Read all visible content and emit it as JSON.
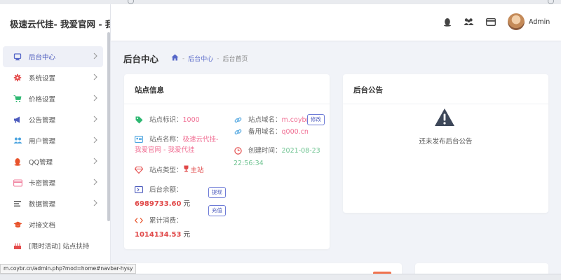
{
  "brand": {
    "title": "极速云代挂- 我爱官网 - 我"
  },
  "sidebar": {
    "items": [
      {
        "label": "后台中心",
        "icon": "monitor-icon",
        "color": "#5667c8",
        "active": true
      },
      {
        "label": "系统设置",
        "icon": "gear-icon",
        "color": "#e44d4d"
      },
      {
        "label": "价格设置",
        "icon": "cart-icon",
        "color": "#2eb872"
      },
      {
        "label": "公告管理",
        "icon": "megaphone-icon",
        "color": "#4c5bbd"
      },
      {
        "label": "用户管理",
        "icon": "users-icon",
        "color": "#4aa3df"
      },
      {
        "label": "QQ管理",
        "icon": "penguin-icon",
        "color": "#e8532b"
      },
      {
        "label": "卡密管理",
        "icon": "card-icon",
        "color": "#f07b9a"
      },
      {
        "label": "数据管理",
        "icon": "list-icon",
        "color": "#555555"
      },
      {
        "label": "对接文档",
        "icon": "graduation-cap-icon",
        "color": "#e8532b"
      },
      {
        "label": "[限时活动] 站点扶持",
        "icon": "cake-icon",
        "color": "#e44d4d"
      }
    ]
  },
  "header": {
    "admin_name": "Admin"
  },
  "page": {
    "title": "后台中心",
    "breadcrumb": {
      "link": "后台中心",
      "current": "后台首页"
    }
  },
  "site_info": {
    "title": "站点信息",
    "site_id_label": "站点标识：",
    "site_id": "1000",
    "site_name_label": "站点名称：",
    "site_name": "极速云代挂- 我爱官网 - 我爱代挂",
    "site_type_label": "站点类型：",
    "site_type": "主站",
    "domain_label": "站点域名：",
    "domain": "m.coybr",
    "domain_edit": "修改",
    "backup_domain_label": "备用域名：",
    "backup_domain": "q000.cn",
    "created_label": "创建时间：",
    "created_date": "2021-08-23",
    "created_time": "22:56:34",
    "balance_label": "后台余额：",
    "balance": "6989733.60",
    "balance_unit": "元",
    "withdraw": "提现",
    "recharge": "充值",
    "spent_label": "累计消费：",
    "spent": "1014134.53",
    "spent_unit": "元"
  },
  "notice": {
    "title": "后台公告",
    "empty_text": "还未发布后台公告"
  },
  "status_url": "m.coybr.cn/admin.php?mod=home#navbar-hysy",
  "colors": {
    "accent": "#5667c8",
    "pink": "#f06e93",
    "green": "#6cc28f",
    "red": "#e04848"
  }
}
